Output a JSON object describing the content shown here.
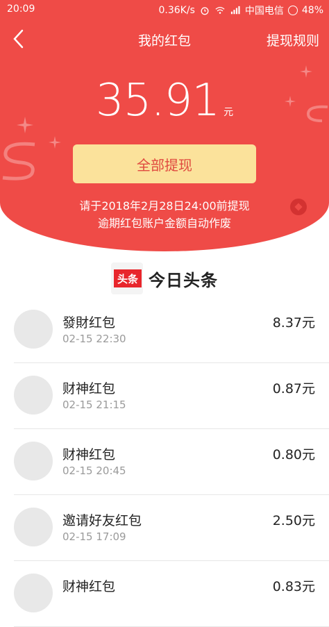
{
  "status_bar": {
    "time": "20:09",
    "speed": "0.36K/s",
    "carrier": "中国电信",
    "battery": "48%"
  },
  "nav": {
    "title": "我的红包",
    "rules_label": "提现规则",
    "back_icon": "chevron-left-icon"
  },
  "balance": {
    "amount": "35.91",
    "unit": "元"
  },
  "withdraw_button": "全部提现",
  "notice": {
    "line1": "请于2018年2月28日24:00前提现",
    "line2": "逾期红包账户金额自动作废"
  },
  "brand": {
    "logo_text": "头条",
    "name": "今日头条"
  },
  "items": [
    {
      "title": "發財红包",
      "time": "02-15 22:30",
      "amount": "8.37元"
    },
    {
      "title": "财神红包",
      "time": "02-15 21:15",
      "amount": "0.87元"
    },
    {
      "title": "财神红包",
      "time": "02-15 20:45",
      "amount": "0.80元"
    },
    {
      "title": "邀请好友红包",
      "time": "02-15 17:09",
      "amount": "2.50元"
    },
    {
      "title": "财神红包",
      "time": "",
      "amount": "0.83元"
    }
  ],
  "colors": {
    "hero_red": "#ef4b47",
    "button_yellow": "#fbe29b",
    "button_text": "#e0493f",
    "brand_red": "#e8262c"
  }
}
